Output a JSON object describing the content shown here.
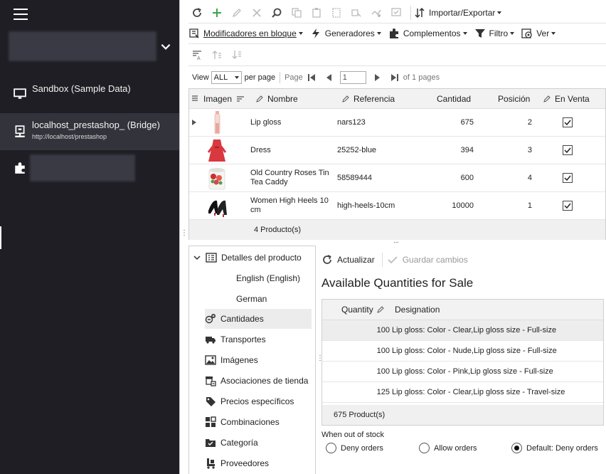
{
  "sidebar": {
    "connections": [
      {
        "title": "Sandbox (Sample Data)",
        "subtitle": ""
      },
      {
        "title": "localhost_prestashop_ (Bridge)",
        "subtitle": "http://localhost/prestashop"
      },
      {
        "title": "",
        "subtitle": ""
      }
    ]
  },
  "toolbar": {
    "import_export": "Importar/Exportar",
    "bulk_modifiers": "Modificadores en bloque",
    "generators": "Generadores",
    "addons": "Complementos",
    "filter": "Filtro",
    "view_menu": "Ver"
  },
  "pager": {
    "view_label": "View",
    "view_value": "ALL",
    "per_page": "per page",
    "page_label": "Page",
    "page_value": "1",
    "of_pages": "of 1 pages"
  },
  "grid": {
    "columns": [
      "Imagen",
      "Nombre",
      "Referencia",
      "Cantidad",
      "Posición",
      "En Venta"
    ],
    "rows": [
      {
        "name": "Lip gloss",
        "reference": "nars123",
        "quantity": "675",
        "position": "2",
        "on_sale": true
      },
      {
        "name": "Dress",
        "reference": "25252-blue",
        "quantity": "394",
        "position": "3",
        "on_sale": true
      },
      {
        "name": "Old Country Roses Tin Tea Caddy",
        "reference": "58589444",
        "quantity": "600",
        "position": "4",
        "on_sale": true
      },
      {
        "name": "Women High Heels 10 cm",
        "reference": "high-heels-10cm",
        "quantity": "10000",
        "position": "1",
        "on_sale": true
      }
    ],
    "footer": "4 Producto(s)"
  },
  "tree": {
    "items": [
      {
        "label": "Detalles del producto",
        "icon": "details-icon"
      },
      {
        "label": "English (English)",
        "icon": ""
      },
      {
        "label": "German",
        "icon": ""
      },
      {
        "label": "Cantidades",
        "icon": "quantities-icon"
      },
      {
        "label": "Transportes",
        "icon": "truck-icon"
      },
      {
        "label": "Imágenes",
        "icon": "image-icon"
      },
      {
        "label": "Asociaciones de tienda",
        "icon": "store-icon"
      },
      {
        "label": "Precios específicos",
        "icon": "tag-icon"
      },
      {
        "label": "Combinaciones",
        "icon": "combinations-icon"
      },
      {
        "label": "Categoría",
        "icon": "category-icon"
      },
      {
        "label": "Proveedores",
        "icon": "suppliers-icon"
      }
    ]
  },
  "detail": {
    "refresh": "Actualizar",
    "save": "Guardar cambios",
    "title": "Available Quantities for Sale",
    "columns": [
      "Quantity",
      "Designation"
    ],
    "rows": [
      {
        "quantity": "100",
        "designation": "Lip gloss: Color - Clear,Lip gloss size - Full-size"
      },
      {
        "quantity": "100",
        "designation": "Lip gloss: Color - Nude,Lip gloss size - Full-size"
      },
      {
        "quantity": "100",
        "designation": "Lip gloss: Color - Pink,Lip gloss size - Full-size"
      },
      {
        "quantity": "125",
        "designation": "Lip gloss: Color - Clear,Lip gloss size - Travel-size"
      }
    ],
    "footer": "675 Product(s)",
    "out_of_stock_label": "When out of stock",
    "options": [
      "Deny orders",
      "Allow orders",
      "Default: Deny orders"
    ],
    "selected_option": 2
  },
  "colors": {
    "sidebar_bg": "#1e1e24",
    "accent_green": "#3aa54a",
    "accent_blue": "#2f6db5"
  }
}
